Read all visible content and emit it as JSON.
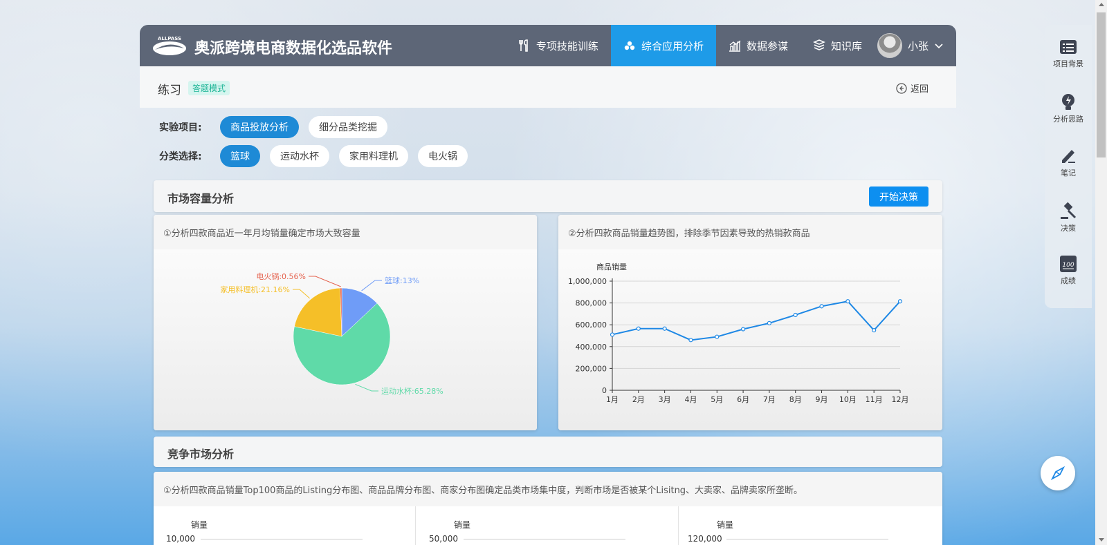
{
  "app": {
    "title": "奥派跨境电商数据化选品软件",
    "logo_text": "ALLPASS"
  },
  "nav": [
    {
      "label": "专项技能训练",
      "icon": "tools-icon"
    },
    {
      "label": "综合应用分析",
      "icon": "cubes-icon",
      "active": true
    },
    {
      "label": "数据参谋",
      "icon": "bar-chart-icon"
    },
    {
      "label": "知识库",
      "icon": "books-icon"
    }
  ],
  "user": {
    "name": "小张"
  },
  "page": {
    "title": "练习",
    "mode_badge": "答题模式",
    "back_label": "返回"
  },
  "filters": {
    "project_label": "实验项目:",
    "projects": [
      "商品投放分析",
      "细分品类挖掘"
    ],
    "category_label": "分类选择:",
    "categories": [
      "篮球",
      "运动水杯",
      "家用料理机",
      "电火锅"
    ]
  },
  "market": {
    "title": "市场容量分析",
    "start_button": "开始决策",
    "panel1_title": "①分析四款商品近一年月均销量确定市场大致容量",
    "panel2_title": "②分析四款商品销量趋势图，排除季节因素导致的热销款商品"
  },
  "competition": {
    "title": "竞争市场分析",
    "panel_title": "①分析四款商品销量Top100商品的Listing分布图、商品品牌分布图、商家分布图确定品类市场集中度，判断市场是否被某个Lisitng、大卖家、品牌卖家所垄断。",
    "mini_ylabel": "销量",
    "mini_top": [
      "10,000",
      "50,000",
      "120,000"
    ]
  },
  "sidebar": [
    {
      "label": "项目背景",
      "icon": "list-icon"
    },
    {
      "label": "分析思路",
      "icon": "bulb-icon"
    },
    {
      "label": "笔记",
      "icon": "pen-icon"
    },
    {
      "label": "决策",
      "icon": "gavel-icon"
    },
    {
      "label": "成绩",
      "icon": "score-icon"
    }
  ],
  "colors": {
    "accent": "#1e9be8",
    "topbar": "#5d6677",
    "line": "#1e88e5"
  },
  "chart_data": [
    {
      "type": "pie",
      "categories": [
        "篮球",
        "运动水杯",
        "家用料理机",
        "电火锅"
      ],
      "values": [
        13,
        65.28,
        21.16,
        0.56
      ],
      "labels": [
        "篮球:13%",
        "运动水杯:65.28%",
        "家用料理机:21.16%",
        "电火锅:0.56%"
      ],
      "colors": [
        "#6f9cf7",
        "#5fdaa8",
        "#f5bf28",
        "#e5624e"
      ]
    },
    {
      "type": "line",
      "ylabel": "商品销量",
      "categories": [
        "1月",
        "2月",
        "3月",
        "4月",
        "5月",
        "6月",
        "7月",
        "8月",
        "9月",
        "10月",
        "11月",
        "12月"
      ],
      "values": [
        510000,
        565000,
        565000,
        460000,
        490000,
        560000,
        615000,
        690000,
        770000,
        815000,
        550000,
        815000
      ],
      "ylim": [
        0,
        1000000
      ],
      "yticks": [
        "0",
        "200,000",
        "400,000",
        "600,000",
        "800,000",
        "1,000,000"
      ],
      "grid": true
    }
  ]
}
